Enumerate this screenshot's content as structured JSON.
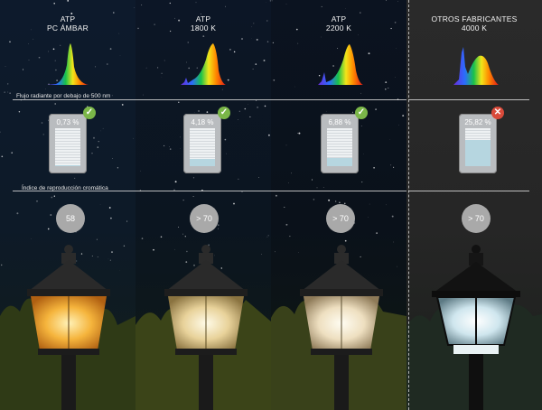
{
  "columns": [
    {
      "header": [
        "ATP",
        "PC ÁMBAR"
      ],
      "percent": "0,73 %",
      "fraction": 0.007,
      "ok": true,
      "cri": "58"
    },
    {
      "header": [
        "ATP",
        "1800 K"
      ],
      "percent": "4,18 %",
      "fraction": 0.18,
      "ok": true,
      "cri": "> 70"
    },
    {
      "header": [
        "ATP",
        "2200 K"
      ],
      "percent": "6,88 %",
      "fraction": 0.22,
      "ok": true,
      "cri": "> 70"
    },
    {
      "header": [
        "OTROS FABRICANTES",
        "4000 K"
      ],
      "percent": "25,82 %",
      "fraction": 0.7,
      "ok": false,
      "cri": "> 70"
    }
  ],
  "sections": {
    "flux_label": "Flujo radiante por debajo de 500 nm",
    "cri_label": "Índice de reproducción cromática"
  },
  "icons": {
    "ok": "check-icon",
    "bad": "cross-icon"
  },
  "colors": {
    "ok": "#7ab648",
    "bad": "#d94a3a"
  }
}
